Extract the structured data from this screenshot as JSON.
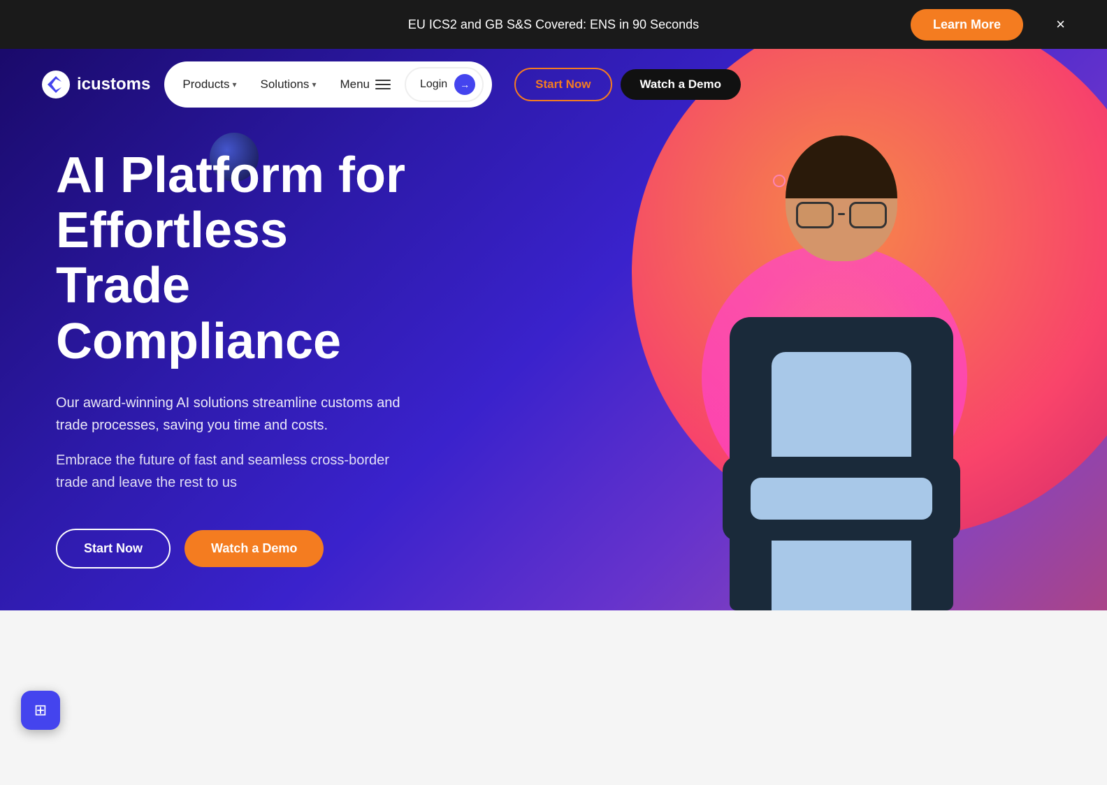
{
  "topBanner": {
    "text": "EU ICS2 and GB S&S Covered: ENS in 90 Seconds",
    "learnMoreLabel": "Learn More",
    "closeLabel": "×"
  },
  "nav": {
    "logoText": "icustoms",
    "productsLabel": "Products",
    "solutionsLabel": "Solutions",
    "menuLabel": "Menu",
    "loginLabel": "Login",
    "startNowLabel": "Start Now",
    "watchDemoLabel": "Watch a Demo"
  },
  "hero": {
    "titleLine1": "AI Platform for",
    "titleLine2": "Effortless Trade",
    "titleLine3": "Compliance",
    "subtitle1": "Our award-winning AI solutions streamline customs and trade processes, saving you time and costs.",
    "subtitle2": "Embrace the future of fast and seamless cross-border trade and leave the rest to us",
    "startNowLabel": "Start Now",
    "watchDemoLabel": "Watch a Demo"
  },
  "belowSection": {
    "placeholder": ""
  },
  "chatWidget": {
    "label": "⊞"
  },
  "colors": {
    "orange": "#f47c20",
    "darkBg": "#1a1a1a",
    "heroBg1": "#1a0a6b",
    "heroBg2": "#3a22cc",
    "accent": "#4444ee"
  }
}
